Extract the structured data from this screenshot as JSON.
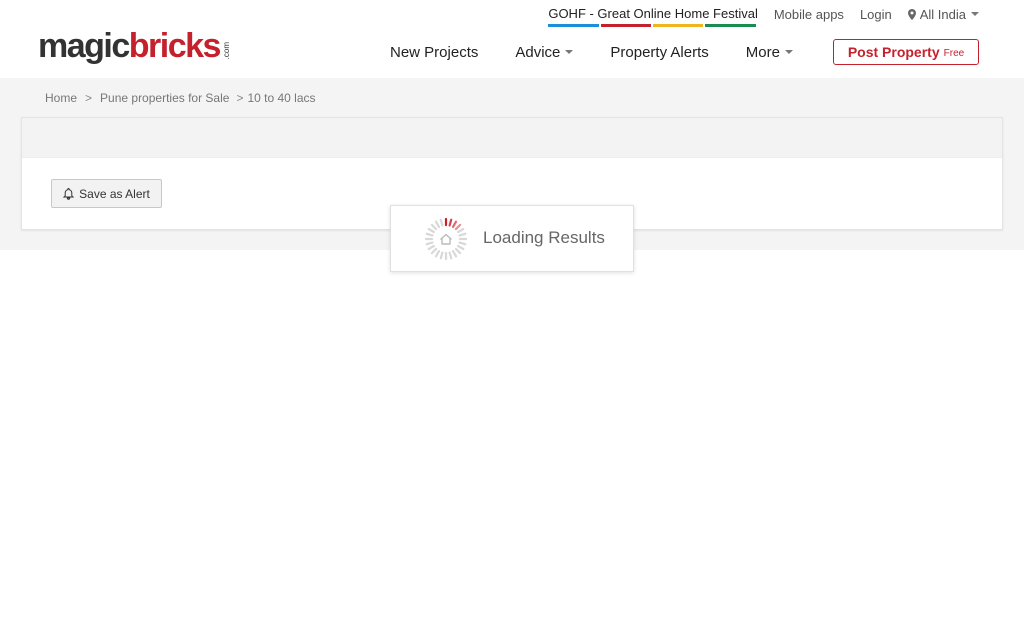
{
  "brand": {
    "part1": "magic",
    "part2": "bricks",
    "suffix": ".com"
  },
  "toplinks": {
    "festival": "GOHF - Great Online Home Festival",
    "festival_colors": [
      "#1b8fd8",
      "#c4212d",
      "#f2b41c",
      "#1a8c4f"
    ],
    "mobile_apps": "Mobile apps",
    "login": "Login",
    "location": "All India"
  },
  "nav": {
    "items": [
      {
        "label": "New Projects",
        "dropdown": false
      },
      {
        "label": "Advice",
        "dropdown": true
      },
      {
        "label": "Property Alerts",
        "dropdown": false
      },
      {
        "label": "More",
        "dropdown": true
      }
    ],
    "post_property": "Post Property",
    "post_property_tag": "Free"
  },
  "breadcrumb": {
    "items": [
      "Home",
      "Pune properties for Sale",
      "10 to 40 lacs"
    ],
    "separator": ">"
  },
  "panel": {
    "save_alert_label": "Save as Alert"
  },
  "loading": {
    "text": "Loading Results"
  },
  "colors": {
    "brand_red": "#c4212d",
    "band_bg": "#f4f4f4"
  }
}
